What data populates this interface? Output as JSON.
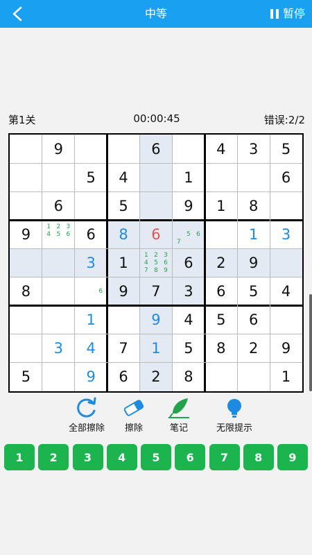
{
  "header": {
    "title": "中等",
    "pause_label": "暂停"
  },
  "status": {
    "level": "第1关",
    "timer": "00:00:45",
    "errors": "错误:2/2"
  },
  "board": {
    "cells": [
      [
        {
          "v": ""
        },
        {
          "v": "9",
          "t": "given"
        },
        {
          "v": ""
        },
        {
          "v": ""
        },
        {
          "v": "6",
          "t": "given"
        },
        {
          "v": ""
        },
        {
          "v": "4",
          "t": "given"
        },
        {
          "v": "3",
          "t": "given"
        },
        {
          "v": "5",
          "t": "given"
        }
      ],
      [
        {
          "v": ""
        },
        {
          "v": ""
        },
        {
          "v": "5",
          "t": "given"
        },
        {
          "v": "4",
          "t": "given"
        },
        {
          "v": ""
        },
        {
          "v": "1",
          "t": "given"
        },
        {
          "v": ""
        },
        {
          "v": ""
        },
        {
          "v": "6",
          "t": "given"
        }
      ],
      [
        {
          "v": ""
        },
        {
          "v": "6",
          "t": "given"
        },
        {
          "v": ""
        },
        {
          "v": "5",
          "t": "given"
        },
        {
          "v": ""
        },
        {
          "v": "9",
          "t": "given"
        },
        {
          "v": "1",
          "t": "given"
        },
        {
          "v": "8",
          "t": "given"
        },
        {
          "v": ""
        }
      ],
      [
        {
          "v": "9",
          "t": "given"
        },
        {
          "notes": [
            "1",
            "2",
            "3",
            "4",
            "5",
            "6",
            "",
            "",
            ""
          ]
        },
        {
          "v": "6",
          "t": "given"
        },
        {
          "v": "8",
          "t": "entered"
        },
        {
          "v": "6",
          "t": "error"
        },
        {
          "notes": [
            "",
            "",
            "",
            "",
            "5",
            "6",
            "7",
            "",
            ""
          ]
        },
        {
          "v": ""
        },
        {
          "v": "1",
          "t": "entered"
        },
        {
          "v": "3",
          "t": "entered"
        }
      ],
      [
        {
          "v": ""
        },
        {
          "v": ""
        },
        {
          "v": "3",
          "t": "entered"
        },
        {
          "v": "1",
          "t": "given"
        },
        {
          "notes": [
            "1",
            "2",
            "3",
            "4",
            "5",
            "6",
            "7",
            "8",
            "9"
          ]
        },
        {
          "v": "6",
          "t": "given"
        },
        {
          "v": "2",
          "t": "given"
        },
        {
          "v": "9",
          "t": "given"
        },
        {
          "v": ""
        }
      ],
      [
        {
          "v": "8",
          "t": "given"
        },
        {
          "v": ""
        },
        {
          "notes": [
            "",
            "",
            "",
            "",
            "",
            "6",
            "",
            "",
            ""
          ]
        },
        {
          "v": "9",
          "t": "given"
        },
        {
          "v": "7",
          "t": "given"
        },
        {
          "v": "3",
          "t": "given"
        },
        {
          "v": "6",
          "t": "given"
        },
        {
          "v": "5",
          "t": "given"
        },
        {
          "v": "4",
          "t": "given"
        }
      ],
      [
        {
          "v": ""
        },
        {
          "v": ""
        },
        {
          "v": "1",
          "t": "entered"
        },
        {
          "v": ""
        },
        {
          "v": "9",
          "t": "entered"
        },
        {
          "v": "4",
          "t": "given"
        },
        {
          "v": "5",
          "t": "given"
        },
        {
          "v": "6",
          "t": "given"
        },
        {
          "v": ""
        }
      ],
      [
        {
          "v": ""
        },
        {
          "v": "3",
          "t": "entered"
        },
        {
          "v": "4",
          "t": "entered"
        },
        {
          "v": "7",
          "t": "given"
        },
        {
          "v": "1",
          "t": "entered"
        },
        {
          "v": "5",
          "t": "given"
        },
        {
          "v": "8",
          "t": "given"
        },
        {
          "v": "2",
          "t": "given"
        },
        {
          "v": "9",
          "t": "given"
        }
      ],
      [
        {
          "v": "5",
          "t": "given"
        },
        {
          "v": ""
        },
        {
          "v": "9",
          "t": "entered"
        },
        {
          "v": "6",
          "t": "given"
        },
        {
          "v": "2",
          "t": "given"
        },
        {
          "v": "8",
          "t": "given"
        },
        {
          "v": ""
        },
        {
          "v": ""
        },
        {
          "v": "1",
          "t": "given"
        }
      ]
    ],
    "selected": {
      "row": 4,
      "col": 4
    }
  },
  "tools": [
    {
      "name": "clear-all",
      "label": "全部擦除",
      "icon": "refresh-icon"
    },
    {
      "name": "erase",
      "label": "擦除",
      "icon": "eraser-icon"
    },
    {
      "name": "notes",
      "label": "笔记",
      "icon": "feather-icon"
    },
    {
      "name": "hint",
      "label": "无限提示",
      "icon": "bulb-icon"
    }
  ],
  "numbers": [
    "1",
    "2",
    "3",
    "4",
    "5",
    "6",
    "7",
    "8",
    "9"
  ],
  "colors": {
    "primary": "#1aa0f0",
    "button": "#1cb44e",
    "highlight": "#e3eaf4",
    "entered": "#1e8be0",
    "error": "#e05454",
    "notes": "#22a24a"
  }
}
